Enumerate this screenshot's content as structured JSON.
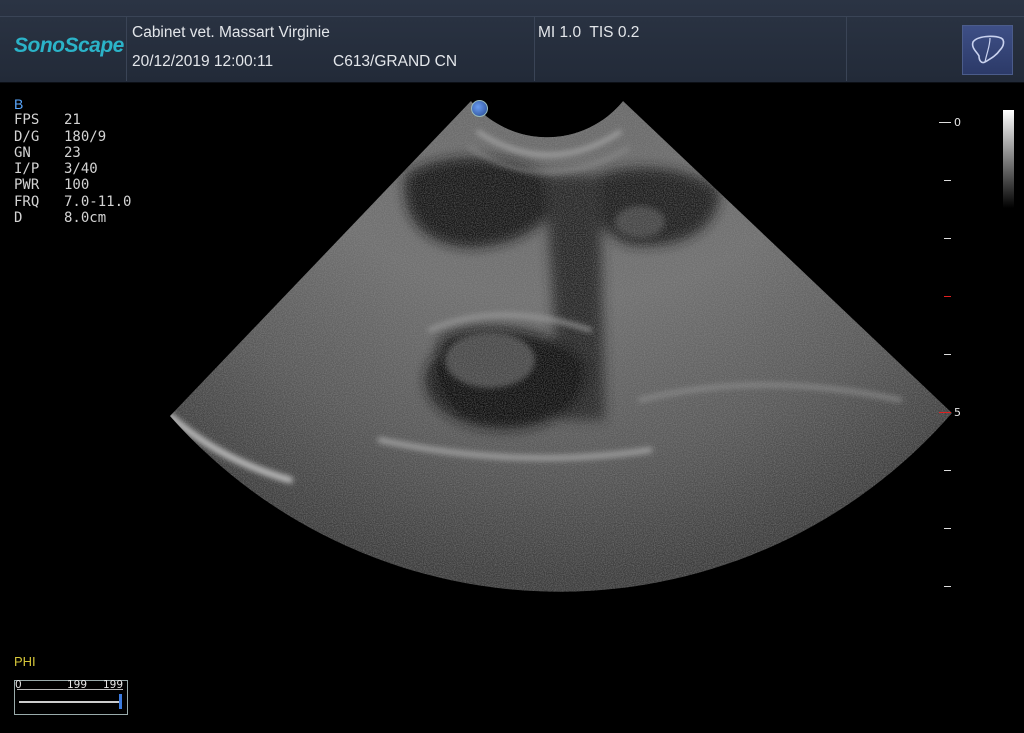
{
  "header": {
    "logo": "SonoScape",
    "clinic": "Cabinet vet. Massart Virginie",
    "datetime": "20/12/2019 12:00:11",
    "probe": "C613/GRAND CN",
    "indices": "MI 1.0  TIS 0.2",
    "organ_icon": "liver-icon"
  },
  "params": {
    "mode": "B",
    "rows": [
      {
        "k": "FPS",
        "v": "21"
      },
      {
        "k": "D/G",
        "v": "180/9"
      },
      {
        "k": "GN",
        "v": "23"
      },
      {
        "k": "I/P",
        "v": "3/40"
      },
      {
        "k": "PWR",
        "v": "100"
      },
      {
        "k": "FRQ",
        "v": "7.0-11.0"
      },
      {
        "k": "D",
        "v": "8.0cm"
      }
    ]
  },
  "depth_scale": {
    "label_top": "0",
    "label_mid": "5"
  },
  "phi": {
    "label": "PHI",
    "min": "0",
    "mid": "199",
    "max": "199"
  },
  "colors": {
    "accent": "#2bb3c8",
    "mode": "#5aa8ff",
    "phi": "#d6c63a",
    "focus": "#e02020"
  }
}
